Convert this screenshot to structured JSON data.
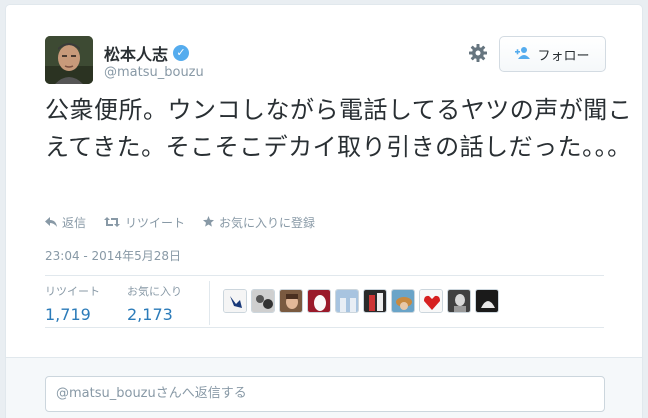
{
  "user": {
    "display_name": "松本人志",
    "handle": "@matsu_bouzu",
    "verified_icon": "✓"
  },
  "header": {
    "follow_label": "フォロー",
    "follow_icon": "person-plus-icon",
    "settings_icon": "gear-icon"
  },
  "tweet": {
    "text": "公衆便所。ウンコしながら電話してるヤツの声が聞こえてきた。そこそこデカイ取り引きの話しだった。。。"
  },
  "actions": {
    "reply_label": "返信",
    "retweet_label": "リツイート",
    "favorite_label": "お気に入りに登録"
  },
  "timestamp": "23:04 - 2014年5月28日",
  "stats": {
    "retweets_label": "リツイート",
    "retweets_value": "1,719",
    "favorites_label": "お気に入り",
    "favorites_value": "2,173"
  },
  "reply": {
    "mention": "@matsu_bouzu",
    "suffix": "さんへ返信する"
  },
  "colors": {
    "accent": "#55acee",
    "link": "#2b7bb9",
    "muted": "#8899a6"
  }
}
